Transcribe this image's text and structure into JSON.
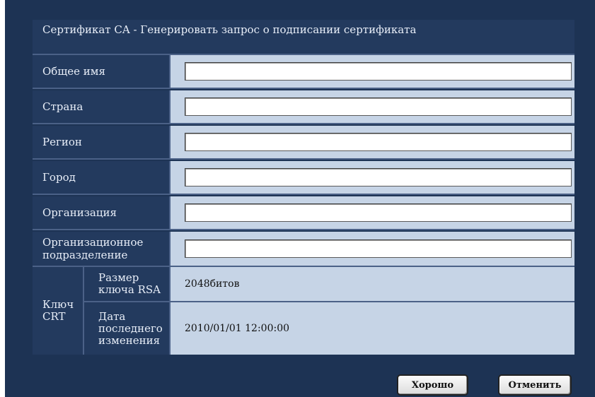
{
  "title": "Сертификат CA - Генерировать запрос о подписании сертификата",
  "fields": [
    {
      "label": "Общее имя",
      "value": "",
      "placeholder": ""
    },
    {
      "label": "Страна",
      "value": "",
      "placeholder": ""
    },
    {
      "label": "Регион",
      "value": "",
      "placeholder": ""
    },
    {
      "label": "Город",
      "value": "",
      "placeholder": ""
    },
    {
      "label": "Организация",
      "value": "",
      "placeholder": ""
    },
    {
      "label": "Организационное подразделение",
      "value": "",
      "placeholder": ""
    }
  ],
  "key": {
    "label": "Ключ CRT",
    "rsa_size_label": "Размер ключа RSA",
    "rsa_size_value": "2048битов",
    "last_modified_label": "Дата последнего изменения",
    "last_modified_value": "2010/01/01 12:00:00"
  },
  "buttons": {
    "ok": "Хорошо",
    "cancel": "Отменить"
  },
  "colors": {
    "background": "#1d3354",
    "label_bg": "#233a5e",
    "value_bg": "#c6d4e6"
  }
}
